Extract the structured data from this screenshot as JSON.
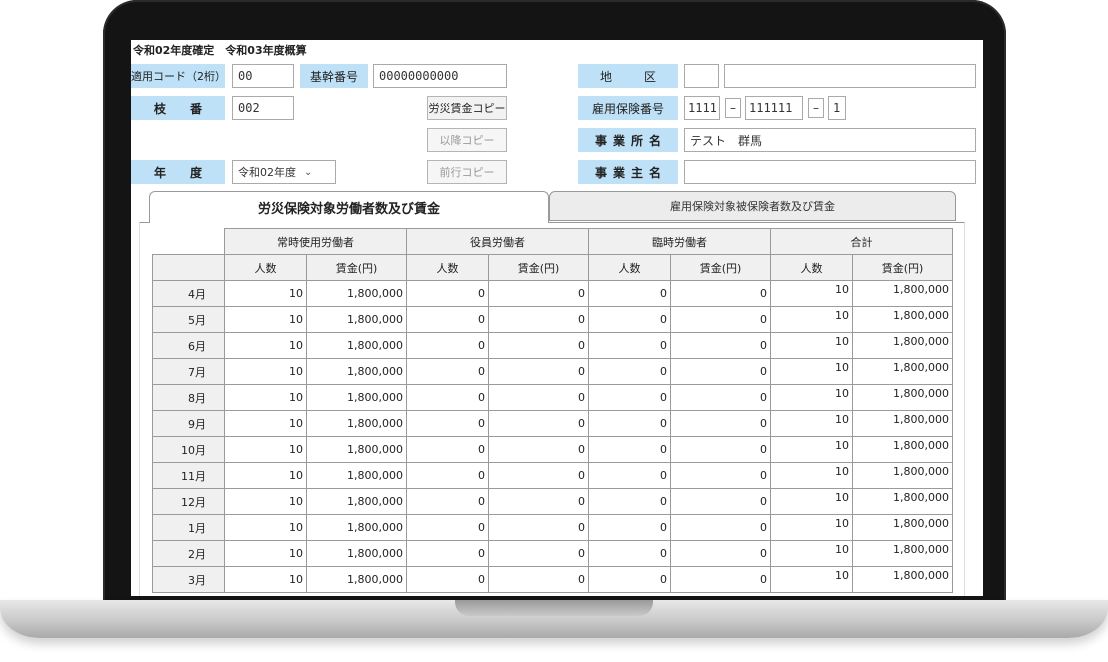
{
  "app": {
    "title": "令和02年度確定　令和03年度概算"
  },
  "form": {
    "tekiyo_code_label": "適用コード（2桁）",
    "tekiyo_code_value": "00",
    "kikan_bango_label": "基幹番号",
    "kikan_bango_value": "00000000000",
    "chiku_label": "地　区",
    "chiku_value_1": "",
    "chiku_value_2": "",
    "edaban_label": "枝　番",
    "edaban_value": "002",
    "rosai_copy_button": "労災賃金コピー",
    "koyo_hoken_label": "雇用保険番号",
    "koyo_hoken_1": "1111",
    "koyo_hoken_2": "111111",
    "koyo_hoken_3": "1",
    "ikou_copy_button": "以降コピー",
    "jigyosho_label": "事業所名",
    "jigyosho_value": "テスト　群馬",
    "nendo_label": "年　度",
    "nendo_value": "令和02年度",
    "zengyo_copy_button": "前行コピー",
    "jigyonushi_label": "事業主名",
    "jigyonushi_value": "",
    "dash": "–"
  },
  "tabs": {
    "active": "労災保険対象労働者数及び賃金",
    "inactive": "雇用保険対象被保険者数及び賃金"
  },
  "table": {
    "groups": [
      "常時使用労働者",
      "役員労働者",
      "臨時労働者",
      "合計"
    ],
    "subheaders": [
      "人数",
      "賃金(円)",
      "人数",
      "賃金(円)",
      "人数",
      "賃金(円)",
      "人数",
      "賃金(円)"
    ],
    "rows": [
      {
        "month": "4月",
        "v": [
          "10",
          "1,800,000",
          "0",
          "0",
          "0",
          "0",
          "10",
          "1,800,000"
        ]
      },
      {
        "month": "5月",
        "v": [
          "10",
          "1,800,000",
          "0",
          "0",
          "0",
          "0",
          "10",
          "1,800,000"
        ]
      },
      {
        "month": "6月",
        "v": [
          "10",
          "1,800,000",
          "0",
          "0",
          "0",
          "0",
          "10",
          "1,800,000"
        ]
      },
      {
        "month": "7月",
        "v": [
          "10",
          "1,800,000",
          "0",
          "0",
          "0",
          "0",
          "10",
          "1,800,000"
        ]
      },
      {
        "month": "8月",
        "v": [
          "10",
          "1,800,000",
          "0",
          "0",
          "0",
          "0",
          "10",
          "1,800,000"
        ]
      },
      {
        "month": "9月",
        "v": [
          "10",
          "1,800,000",
          "0",
          "0",
          "0",
          "0",
          "10",
          "1,800,000"
        ]
      },
      {
        "month": "10月",
        "v": [
          "10",
          "1,800,000",
          "0",
          "0",
          "0",
          "0",
          "10",
          "1,800,000"
        ]
      },
      {
        "month": "11月",
        "v": [
          "10",
          "1,800,000",
          "0",
          "0",
          "0",
          "0",
          "10",
          "1,800,000"
        ]
      },
      {
        "month": "12月",
        "v": [
          "10",
          "1,800,000",
          "0",
          "0",
          "0",
          "0",
          "10",
          "1,800,000"
        ]
      },
      {
        "month": "1月",
        "v": [
          "10",
          "1,800,000",
          "0",
          "0",
          "0",
          "0",
          "10",
          "1,800,000"
        ]
      },
      {
        "month": "2月",
        "v": [
          "10",
          "1,800,000",
          "0",
          "0",
          "0",
          "0",
          "10",
          "1,800,000"
        ]
      },
      {
        "month": "3月",
        "v": [
          "10",
          "1,800,000",
          "0",
          "0",
          "0",
          "0",
          "10",
          "1,800,000"
        ]
      }
    ]
  },
  "colors": {
    "label_bg": "#bfe1f7",
    "header_bg": "#f0f0f0",
    "tab_inactive_bg": "#ececec"
  },
  "icons": {
    "select_arrow": "chevron-down-icon"
  }
}
